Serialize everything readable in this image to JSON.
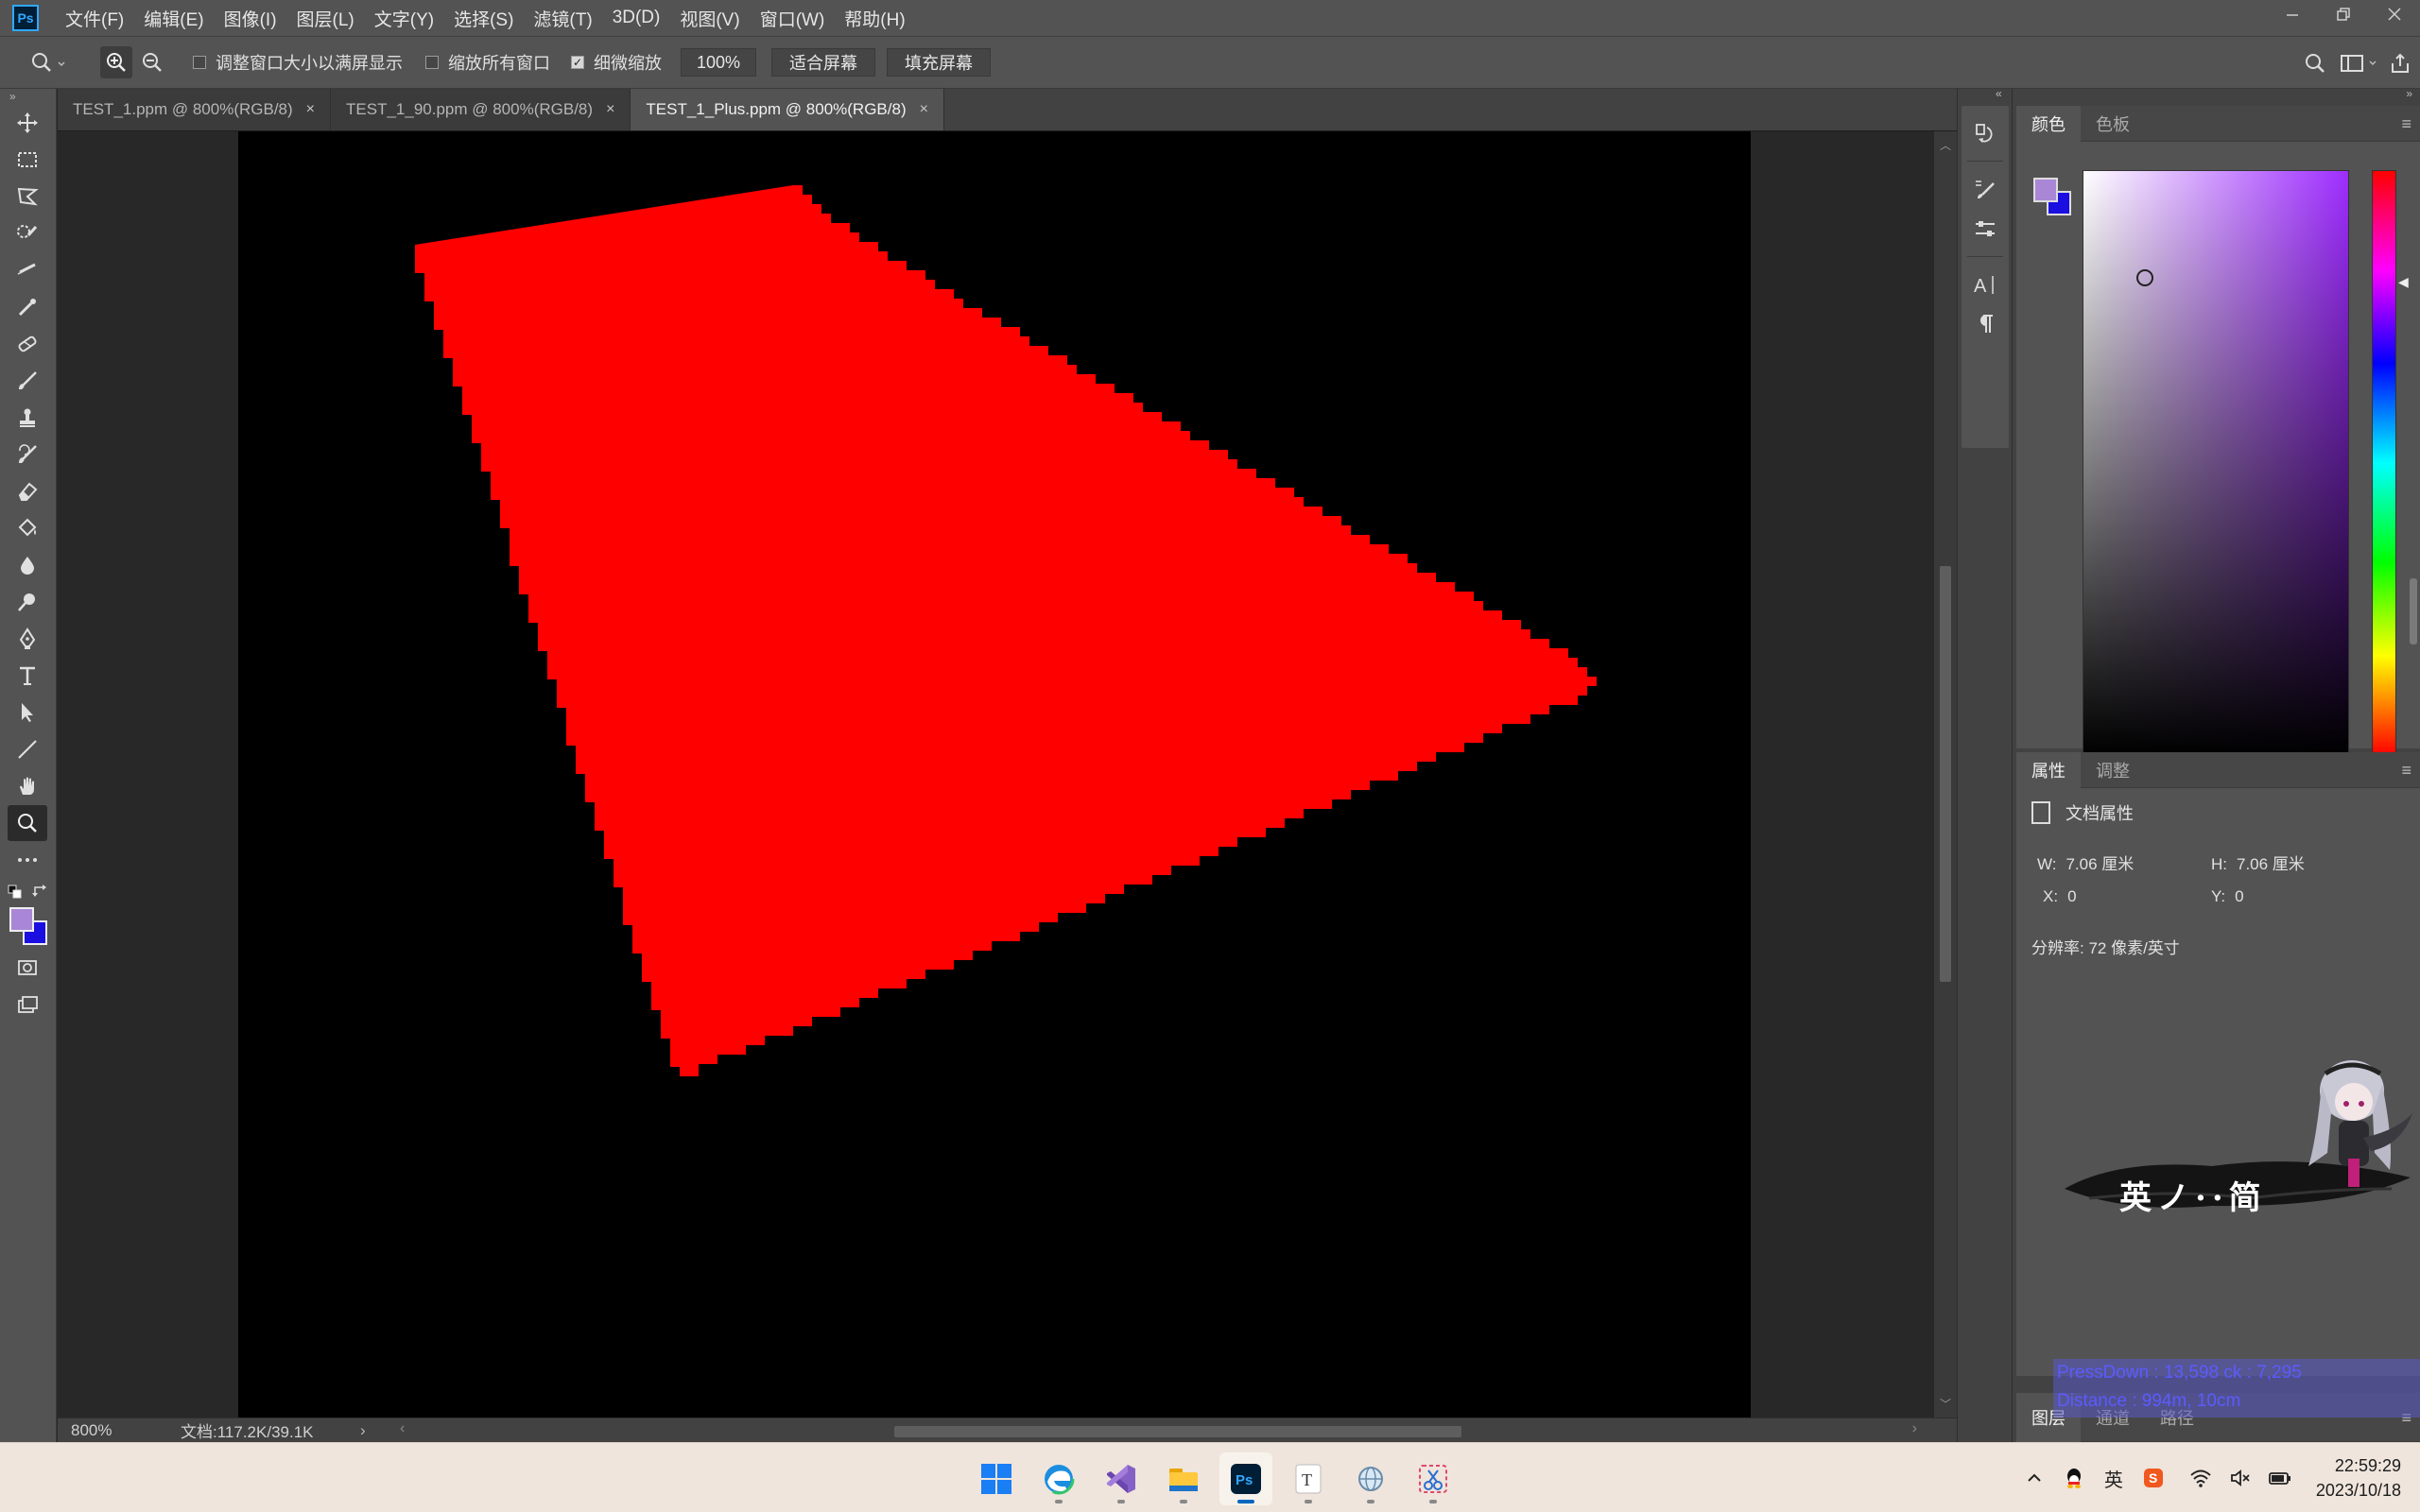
{
  "menubar": {
    "logo": "Ps",
    "items": [
      "文件(F)",
      "编辑(E)",
      "图像(I)",
      "图层(L)",
      "文字(Y)",
      "选择(S)",
      "滤镜(T)",
      "3D(D)",
      "视图(V)",
      "窗口(W)",
      "帮助(H)"
    ],
    "window_controls": [
      "minimize-icon",
      "restore-icon",
      "close-icon"
    ]
  },
  "options": {
    "tool_icon": "zoom-icon",
    "zoom_in_icon": "zoom-in-icon",
    "zoom_out_icon": "zoom-out-icon",
    "resize_windows_label": "调整窗口大小以满屏显示",
    "resize_windows_checked": false,
    "zoom_all_label": "缩放所有窗口",
    "zoom_all_checked": false,
    "scrubby_label": "细微缩放",
    "scrubby_checked": true,
    "zoom_value": "100%",
    "fit_screen_label": "适合屏幕",
    "fill_screen_label": "填充屏幕"
  },
  "toolbar": {
    "tools": [
      "move-tool",
      "marquee-tool",
      "lasso-tool",
      "quick-select-tool",
      "eyedropper-tool",
      "eyedropper-tool",
      "healing-brush-tool",
      "brush-tool",
      "stamp-tool",
      "history-brush-tool",
      "eraser-tool",
      "paint-bucket-tool",
      "blur-tool",
      "dodge-tool",
      "pen-tool",
      "type-tool",
      "path-select-tool",
      "line-tool",
      "hand-tool",
      "zoom-tool",
      "more-tools"
    ],
    "active_tool": "zoom-tool",
    "foreground_color": "#a987d6",
    "background_color": "#1b0ee0"
  },
  "tabs": [
    {
      "label": "TEST_1.ppm @ 800%(RGB/8)",
      "active": false
    },
    {
      "label": "TEST_1_90.ppm @ 800%(RGB/8)",
      "active": false
    },
    {
      "label": "TEST_1_Plus.ppm @ 800%(RGB/8)",
      "active": true
    }
  ],
  "tab_close_glyph": "×",
  "canvas": {
    "background": "#000000",
    "shape_color": "#ff0000",
    "shape": "red triangle"
  },
  "status": {
    "zoom": "800%",
    "doc_size": "文档:117.2K/39.1K"
  },
  "color_panel": {
    "tabs": [
      "颜色",
      "色板"
    ],
    "active_tab": "颜色",
    "foreground": "#a987d6",
    "background": "#1b0ee0"
  },
  "properties_panel": {
    "tabs": [
      "属性",
      "调整"
    ],
    "active_tab": "属性",
    "header": "文档属性",
    "w_label": "W:",
    "w_value": "7.06 厘米",
    "h_label": "H:",
    "h_value": "7.06 厘米",
    "x_label": "X:",
    "x_value": "0",
    "y_label": "Y:",
    "y_value": "0",
    "resolution": "分辨率: 72 像素/英寸"
  },
  "mascot_text": "英ノ··简",
  "layers_panel": {
    "tabs": [
      "图层",
      "通道",
      "路径"
    ],
    "active_tab": "图层"
  },
  "overlay": {
    "line1": "PressDown :        13,598 ck :       7,295",
    "line2": "Distance :    994m, 10cm"
  },
  "taskbar": {
    "apps": [
      "windows-start-icon",
      "edge-icon",
      "visual-studio-icon",
      "file-explorer-icon",
      "photoshop-icon",
      "typora-icon",
      "network-app-icon",
      "snipping-tool-icon"
    ],
    "active_app": "photoshop-icon",
    "tray": [
      "chevron-up-icon",
      "qq-icon",
      "ime-icon",
      "sogou-icon",
      "wifi-icon",
      "volume-muted-icon",
      "battery-icon"
    ],
    "ime_label": "英",
    "time": "22:59:29",
    "date": "2023/10/18"
  }
}
